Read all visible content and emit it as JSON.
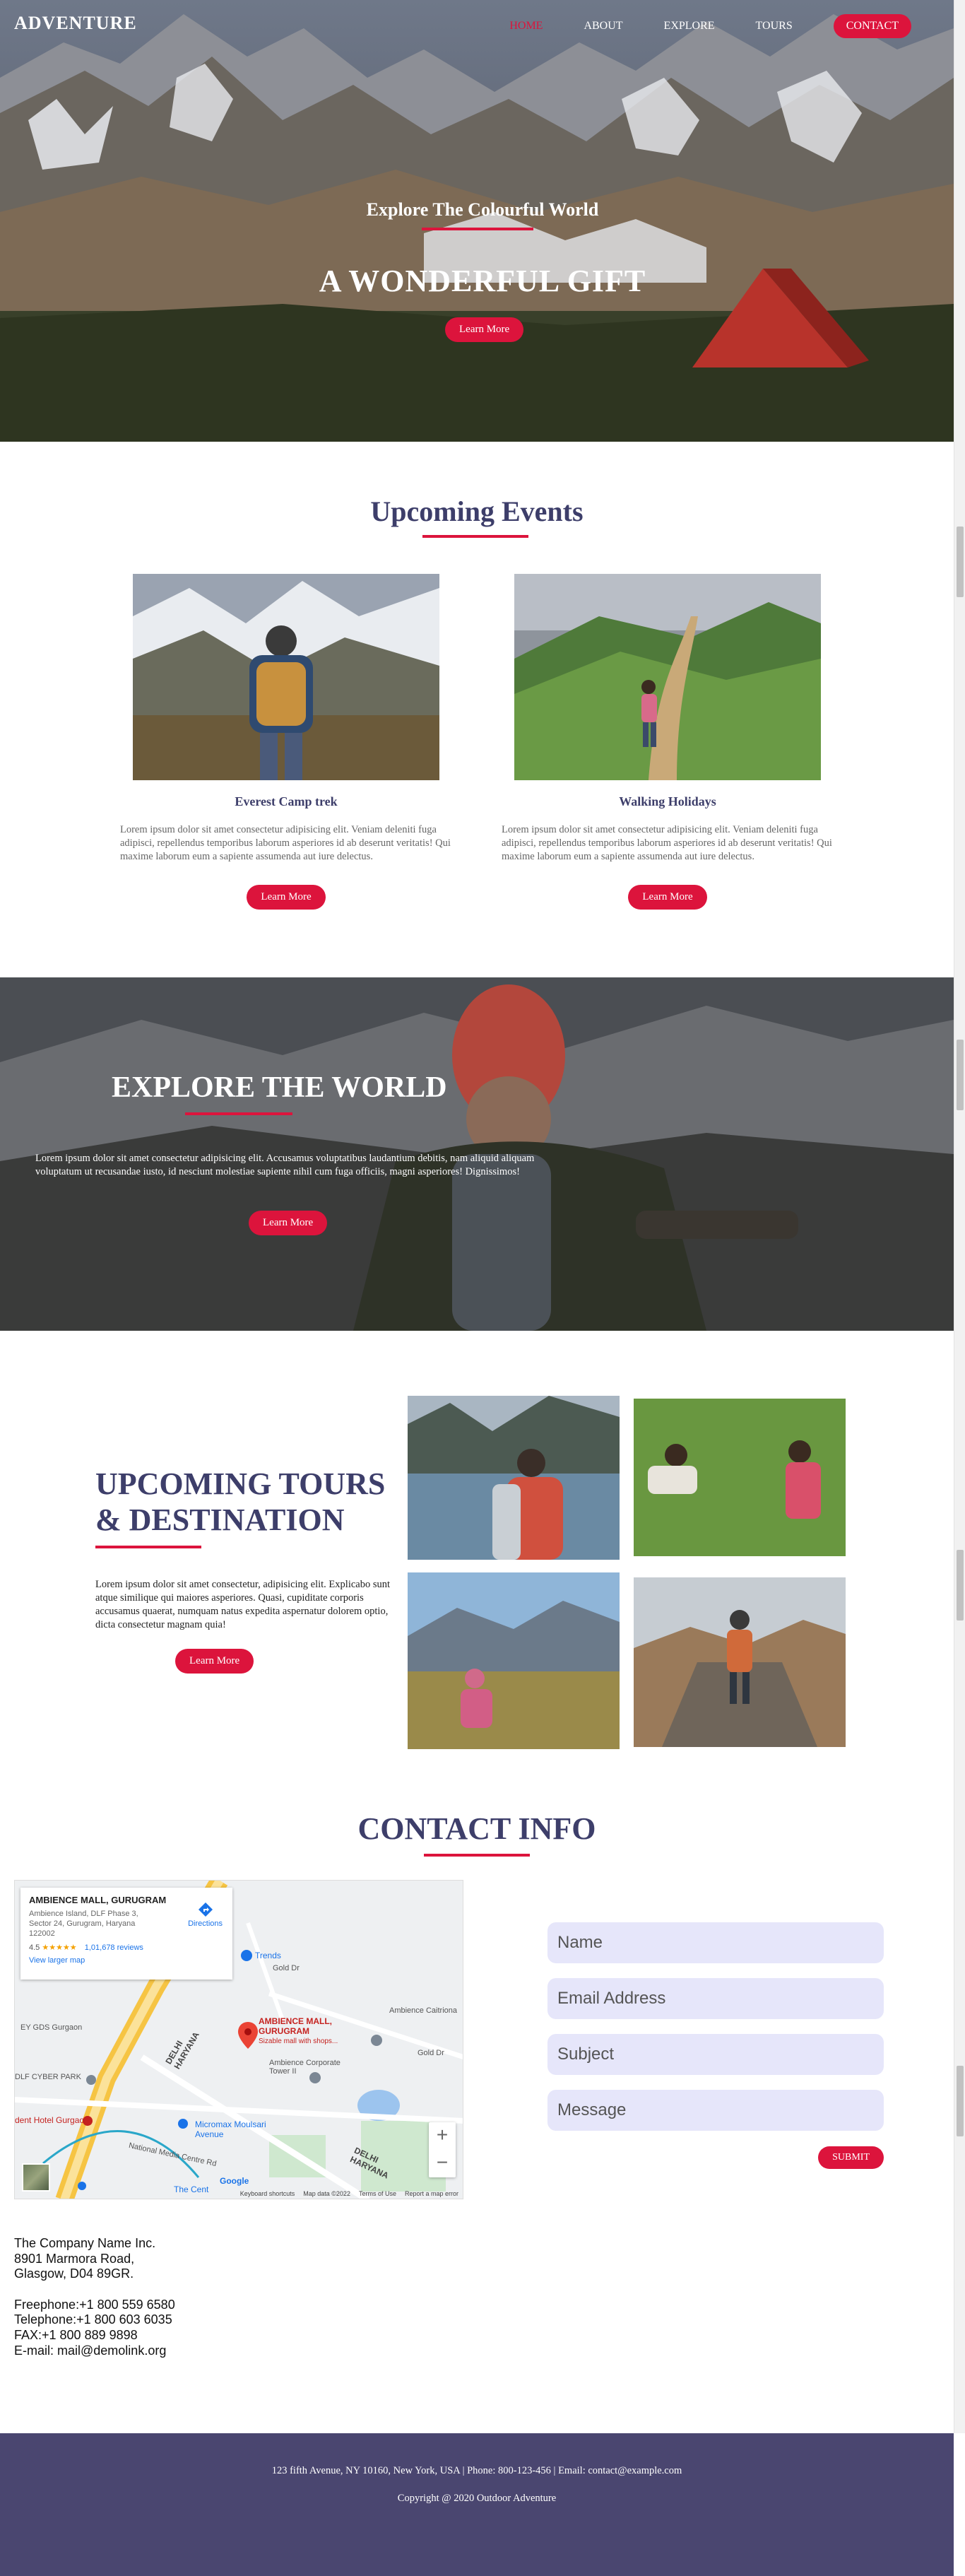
{
  "brand": "ADVENTURE",
  "nav": {
    "home": "HOME",
    "about": "ABOUT",
    "explore": "EXPLORE",
    "tours": "TOURS",
    "contact": "CONTACT",
    "active_color": "#dc143c"
  },
  "hero": {
    "subtitle": "Explore The Colourful World",
    "title": "A WONDERFUL GIFT",
    "button": "Learn More"
  },
  "events": {
    "title": "Upcoming Events",
    "cards": [
      {
        "name": "Everest Camp trek",
        "text": "Lorem ipsum dolor sit amet consectetur adipisicing elit. Veniam deleniti fuga adipisci, repellendus temporibus laborum asperiores id ab deserunt veritatis! Qui maxime laborum eum a sapiente assumenda aut iure delectus.",
        "button": "Learn More"
      },
      {
        "name": "Walking Holidays",
        "text": "Lorem ipsum dolor sit amet consectetur adipisicing elit. Veniam deleniti fuga adipisci, repellendus temporibus laborum asperiores id ab deserunt veritatis! Qui maxime laborum eum a sapiente assumenda aut iure delectus.",
        "button": "Learn More"
      }
    ]
  },
  "explore": {
    "title": "EXPLORE THE WORLD",
    "text": "Lorem ipsum dolor sit amet consectetur adipisicing elit. Accusamus voluptatibus laudantium debitis, nam aliquid aliquam voluptatum ut recusandae iusto, id nesciunt molestiae sapiente nihil cum fuga officiis, magni asperiores! Dignissimos!",
    "button": "Learn More"
  },
  "tours": {
    "title_line1": "UPCOMING TOURS",
    "title_line2": "& DESTINATION",
    "text": "Lorem ipsum dolor sit amet consectetur, adipisicing elit. Explicabo sunt atque similique qui maiores asperiores. Quasi, cupiditate corporis accusamus quaerat, numquam natus expedita aspernatur dolorem optio, dicta consectetur magnam quia!",
    "button": "Learn More"
  },
  "contact": {
    "title": "CONTACT INFO",
    "map": {
      "place_name": "AMBIENCE MALL, GURUGRAM",
      "address": "Ambience Island, DLF Phase 3, Sector 24, Gurugram, Haryana 122002",
      "rating": "4.5",
      "stars": "★★★★★",
      "reviews": "1,01,678 reviews",
      "view_larger": "View larger map",
      "directions": "Directions",
      "pin_label": "AMBIENCE MALL, GURUGRAM",
      "pin_sub": "Sizable mall with shops...",
      "labels": {
        "trends": "Trends",
        "ambience_caitriona": "Ambience Caitriona",
        "ambience_corporate": "Ambience Corporate Tower II",
        "gurgaon": "EY GDS Gurgaon",
        "cyber_park": "DLF CYBER PARK",
        "hotel": "dent Hotel Gurgaon",
        "delhi_haryana_1": "DELHI HARYANA",
        "delhi_haryana_2": "DELHI HARYANA",
        "micromax": "Micromax Moulsari Avenue",
        "national_media": "National Media Centre Rd",
        "gold_dr_1": "Gold Dr",
        "gold_dr_2": "Gold Dr",
        "the_cent": "The Cent",
        "google": "Google"
      },
      "zoom_in": "+",
      "zoom_out": "−",
      "footer": [
        "Keyboard shortcuts",
        "Map data ©2022",
        "Terms of Use",
        "Report a map error"
      ]
    },
    "form": {
      "name_placeholder": "Name",
      "email_placeholder": "Email Address",
      "subject_placeholder": "Subject",
      "message_placeholder": "Message",
      "submit": "SUBMIT"
    },
    "address": {
      "company": "The Company Name Inc.",
      "street": "8901 Marmora Road,",
      "city": "Glasgow, D04 89GR.",
      "freephone": "Freephone:+1 800 559 6580",
      "telephone": "Telephone:+1 800 603 6035",
      "fax": "FAX:+1 800 889 9898",
      "email": "E-mail: mail@demolink.org"
    }
  },
  "footer": {
    "line1": "123 fifth Avenue, NY 10160, New York, USA | Phone: 800-123-456 | Email: contact@example.com",
    "line2": "Copyright @ 2020 Outdoor Adventure"
  }
}
